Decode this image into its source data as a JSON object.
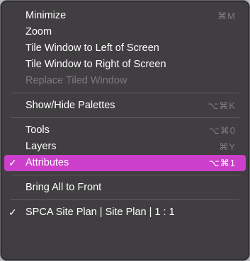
{
  "menu": {
    "groups": [
      {
        "items": [
          {
            "label": "Minimize",
            "shortcut": "⌘M"
          },
          {
            "label": "Zoom",
            "shortcut": ""
          },
          {
            "label": "Tile Window to Left of Screen",
            "shortcut": ""
          },
          {
            "label": "Tile Window to Right of Screen",
            "shortcut": ""
          },
          {
            "label": "Replace Tiled Window",
            "shortcut": ""
          }
        ]
      },
      {
        "items": [
          {
            "label": "Show/Hide Palettes",
            "shortcut": "⌥⌘K"
          }
        ]
      },
      {
        "items": [
          {
            "label": "Tools",
            "shortcut": "⌥⌘0"
          },
          {
            "label": "Layers",
            "shortcut": "⌘Y"
          },
          {
            "label": "Attributes",
            "shortcut": "⌥⌘1",
            "check": "✓"
          }
        ]
      },
      {
        "items": [
          {
            "label": "Bring All to Front",
            "shortcut": ""
          }
        ]
      },
      {
        "items": [
          {
            "label": "SPCA Site Plan | Site Plan | 1 : 1",
            "shortcut": "",
            "check": "✓"
          }
        ]
      }
    ]
  },
  "colors": {
    "menu_background": "#403e40",
    "highlight": "#cc3fcb",
    "disabled_text": "#7d7b7d",
    "separator": "#5f5d5f"
  }
}
